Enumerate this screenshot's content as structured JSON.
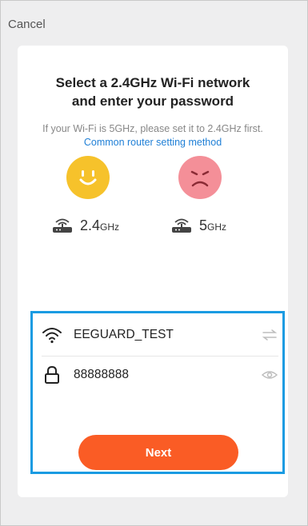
{
  "header": {
    "cancel_label": "Cancel"
  },
  "card": {
    "title_line1": "Select a 2.4GHz Wi-Fi network",
    "title_line2": "and enter your password",
    "subtitle_text": "If your Wi-Fi is 5GHz, please set it to 2.4GHz first. ",
    "subtitle_link": "Common router setting method"
  },
  "bands": {
    "supported": {
      "number": "2.4",
      "unit": "GHz",
      "icon": "smile-face-icon",
      "color": "#f6c22b"
    },
    "unsupported": {
      "number": "5",
      "unit": "GHz",
      "icon": "sad-face-icon",
      "color": "#f48f98"
    }
  },
  "form": {
    "wifi_name": "EEGUARD_TEST",
    "wifi_icon": "wifi-icon",
    "switch_icon": "switch-network-icon",
    "password": "88888888",
    "lock_icon": "lock-icon",
    "eye_icon": "show-password-icon",
    "next_label": "Next",
    "accent": "#fa5c25",
    "highlight_color": "#1a9be2"
  }
}
